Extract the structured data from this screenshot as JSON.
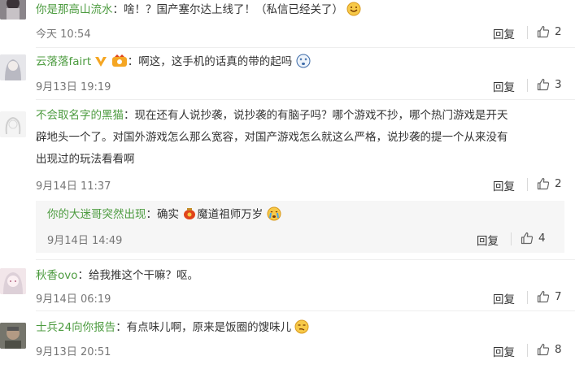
{
  "comments": [
    {
      "author": "你是那高山流水",
      "text": "：啥！？国产塞尔达上线了！（私信已经关了）",
      "time": "今天 10:54",
      "reply": "回复",
      "likes": "2",
      "emoji": "laugh-emoji"
    },
    {
      "author": "云落落fairt",
      "text": "：啊这，这手机的话真的带的起吗",
      "time": "9月13日 19:19",
      "reply": "回复",
      "likes": "3",
      "emoji": "dizzy-emoji"
    },
    {
      "author": "不会取名字的黑猫",
      "text_line1": "：现在还有人说抄袭，说抄袭的有脑子吗？哪个游戏不抄，哪个热门游戏是开天",
      "text_line2": "辟地头一个了。对国外游戏怎么那么宽容，对国产游戏怎么就这么严格，说抄袭的提一个从来没有",
      "text_line3": "出现过的玩法看看啊",
      "time": "9月14日 11:37",
      "reply": "回复",
      "likes": "2",
      "sub_reply": {
        "author": "你的大迷哥突然出现",
        "text_a": "：确实",
        "text_b": "魔道祖师万岁",
        "time": "9月14日 14:49",
        "reply": "回复",
        "likes": "4"
      }
    },
    {
      "author": "秋香ovo",
      "text": "：给我推这个干嘛？呕。",
      "time": "9月14日 06:19",
      "reply": "回复",
      "likes": "7"
    },
    {
      "author": "士兵24向你报告",
      "text": "：有点味儿啊，原来是饭圈的馊味儿",
      "time": "9月13日 20:51",
      "reply": "回复",
      "likes": "8",
      "emoji": "smirk-emoji"
    }
  ],
  "colors": {
    "author": "#4c9b3f",
    "meta": "#777777",
    "divider": "#eeeeee",
    "sub_bg": "#f6f6f6"
  },
  "icons": [
    "thumbs-up-icon",
    "verified-v-icon",
    "vip-badge-icon"
  ]
}
